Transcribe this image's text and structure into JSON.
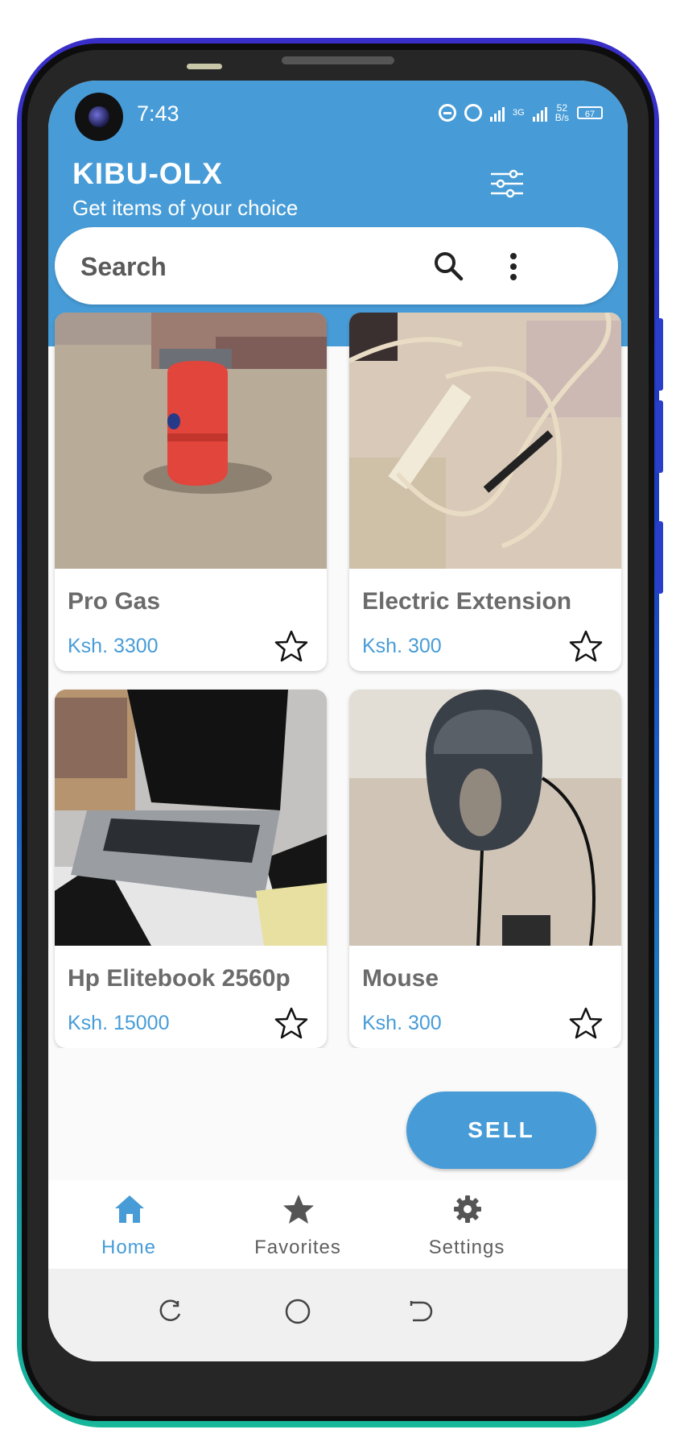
{
  "status_bar": {
    "time": "7:43",
    "network_type": "3G",
    "net_speed_value": "52",
    "net_speed_unit": "B/s",
    "battery": "67"
  },
  "header": {
    "title": "KIBU-OLX",
    "subtitle": "Get items of your choice",
    "filter_icon": "sliders-icon"
  },
  "search": {
    "placeholder": "Search",
    "search_icon": "search-icon",
    "more_icon": "more-vertical-icon"
  },
  "products": [
    {
      "name": "Pro Gas",
      "price": "Ksh. 3300"
    },
    {
      "name": "Electric Extension",
      "price": "Ksh. 300"
    },
    {
      "name": "Hp Elitebook 2560p",
      "price": "Ksh. 15000"
    },
    {
      "name": "Mouse",
      "price": "Ksh. 300"
    }
  ],
  "sell_button": {
    "label": "SELL"
  },
  "bottom_nav": {
    "items": [
      {
        "label": "Home",
        "icon": "home-icon",
        "active": true
      },
      {
        "label": "Favorites",
        "icon": "star-icon",
        "active": false
      },
      {
        "label": "Settings",
        "icon": "gear-icon",
        "active": false
      }
    ]
  },
  "colors": {
    "primary": "#479cd7",
    "text_gray": "#6b6b6b",
    "background": "#fafafa"
  }
}
